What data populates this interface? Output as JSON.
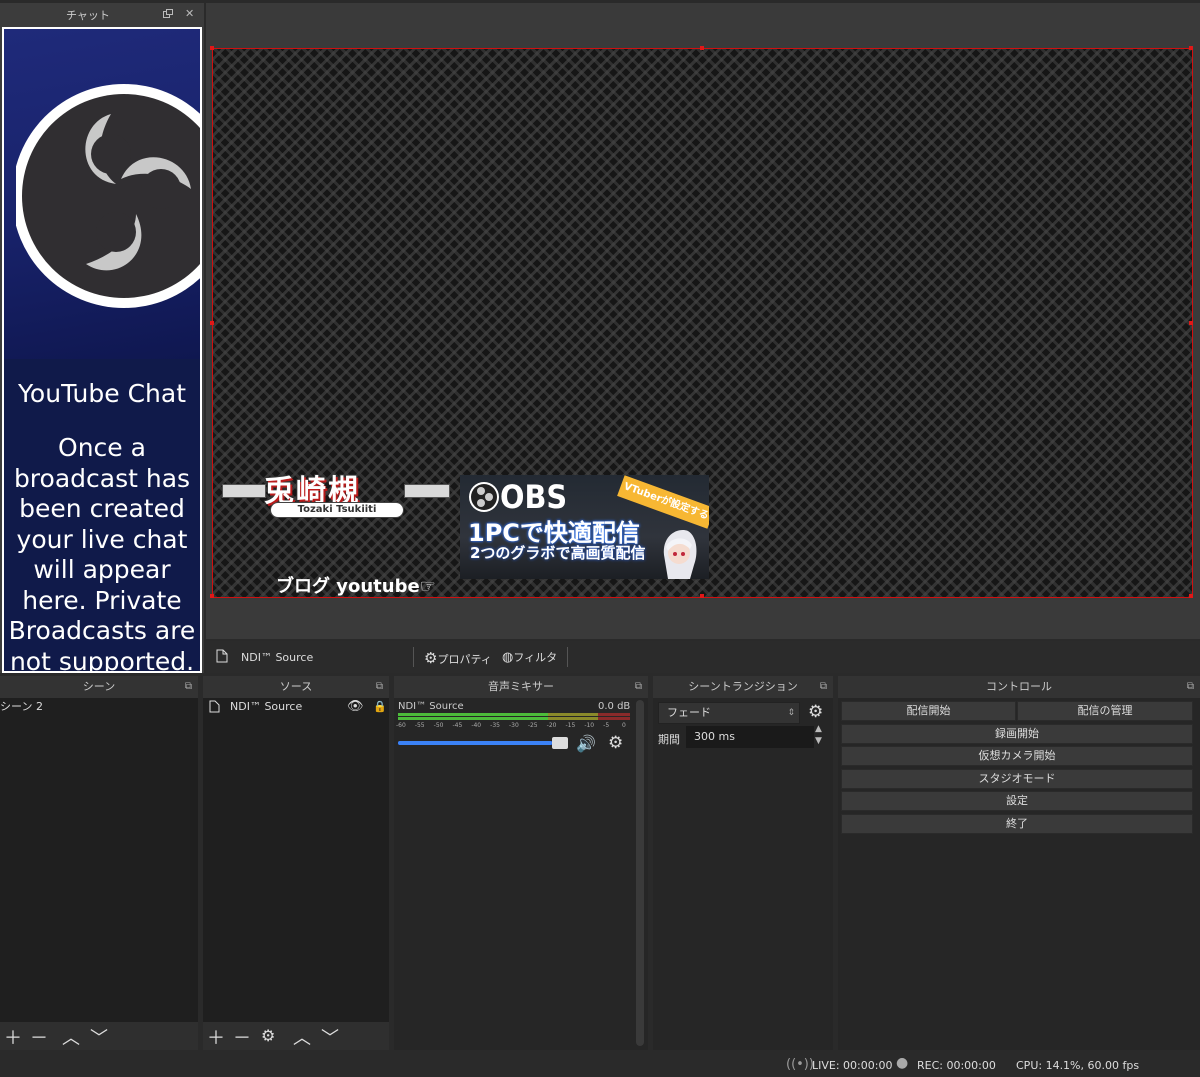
{
  "chat": {
    "title": "チャット",
    "float_icon": "float-icon",
    "close_glyph": "✕",
    "heading": "YouTube Chat",
    "message": "Once a broadcast has been created your live chat will appear here. Private Broadcasts are not supported."
  },
  "preview": {
    "brand_name": "兎崎槻",
    "brand_romaji": "Tozaki Tsukiiti",
    "blog_caption": "ブログ youtube☞",
    "thumb_obs": "OBS",
    "thumb_ribbon": "VTuberが設定する",
    "thumb_line1": "1PCで快適配信",
    "thumb_line2": "2つのグラボで高画質配信",
    "border_color": "#d01010"
  },
  "source_toolbar": {
    "source_name": "NDI™ Source",
    "properties_label": "プロパティ",
    "filters_label": "フィルタ"
  },
  "scenes": {
    "title": "シーン",
    "items": [
      "シーン 2"
    ]
  },
  "sources": {
    "title": "ソース",
    "items": [
      "NDI™ Source"
    ]
  },
  "mixer": {
    "title": "音声ミキサー",
    "channel_name": "NDI™ Source",
    "db_value": "0.0 dB",
    "ticks": [
      "-60",
      "-55",
      "-50",
      "-45",
      "-40",
      "-35",
      "-30",
      "-25",
      "-20",
      "-15",
      "-10",
      "-5",
      "0"
    ],
    "volume_fraction": 1.0
  },
  "transitions": {
    "title": "シーントランジション",
    "selected": "フェード",
    "duration_label": "期間",
    "duration_value": "300 ms"
  },
  "controls": {
    "title": "コントロール",
    "start_streaming": "配信開始",
    "manage_broadcast": "配信の管理",
    "start_recording": "録画開始",
    "start_virtualcam": "仮想カメラ開始",
    "studio_mode": "スタジオモード",
    "settings": "設定",
    "exit": "終了"
  },
  "status": {
    "live": "LIVE: 00:00:00",
    "rec": "REC: 00:00:00",
    "cpu": "CPU: 14.1%, 60.00 fps"
  }
}
